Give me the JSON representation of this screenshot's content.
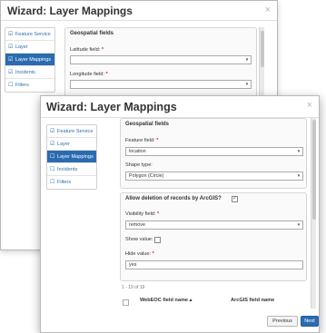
{
  "colors": {
    "accent": "#2b6bb0",
    "required": "#d9231d",
    "link": "#2f6fad"
  },
  "back_dialog": {
    "title": "Wizard: Layer Mappings",
    "close": "×",
    "nav": [
      {
        "icon": "☑",
        "label": "Feature Service"
      },
      {
        "icon": "☑",
        "label": "Layer"
      },
      {
        "icon": "☑",
        "label": "Layer Mappings"
      },
      {
        "icon": "☑",
        "label": "Incidents"
      },
      {
        "icon": "☐",
        "label": "Filters"
      }
    ],
    "section_title": "Geospatial fields",
    "latitude_label": "Latitude field:",
    "longitude_label": "Longitude field:",
    "required_mark": "*",
    "caret": "▾"
  },
  "front_dialog": {
    "title": "Wizard: Layer Mappings",
    "close": "×",
    "nav": [
      {
        "icon": "☑",
        "label": "Feature Service"
      },
      {
        "icon": "☑",
        "label": "Layer"
      },
      {
        "icon": "☐",
        "label": "Layer Mappings"
      },
      {
        "icon": "☐",
        "label": "Incidents"
      },
      {
        "icon": "☐",
        "label": "Filters"
      }
    ],
    "geospatial": {
      "title": "Geospatial fields",
      "feature_field_label": "Feature field:",
      "feature_field_value": "location",
      "shape_type_label": "Shape type:",
      "shape_type_value": "Polygon (Circle)"
    },
    "deletion": {
      "title": "Allow deletion of records by ArcGIS?",
      "checked_mark": "✓",
      "visibility_label": "Visibility field:",
      "visibility_value": "remove",
      "show_value_label": "Show value:",
      "hide_value_label": "Hide value:",
      "hide_value": "yes"
    },
    "table": {
      "count": "1 - 19 of 19",
      "col1": "WebEOC field name",
      "sort_icon": "▴",
      "col2": "ArcGIS field name"
    },
    "required_mark": "*",
    "caret": "▾",
    "buttons": {
      "previous": "Previous",
      "next": "Next"
    }
  }
}
